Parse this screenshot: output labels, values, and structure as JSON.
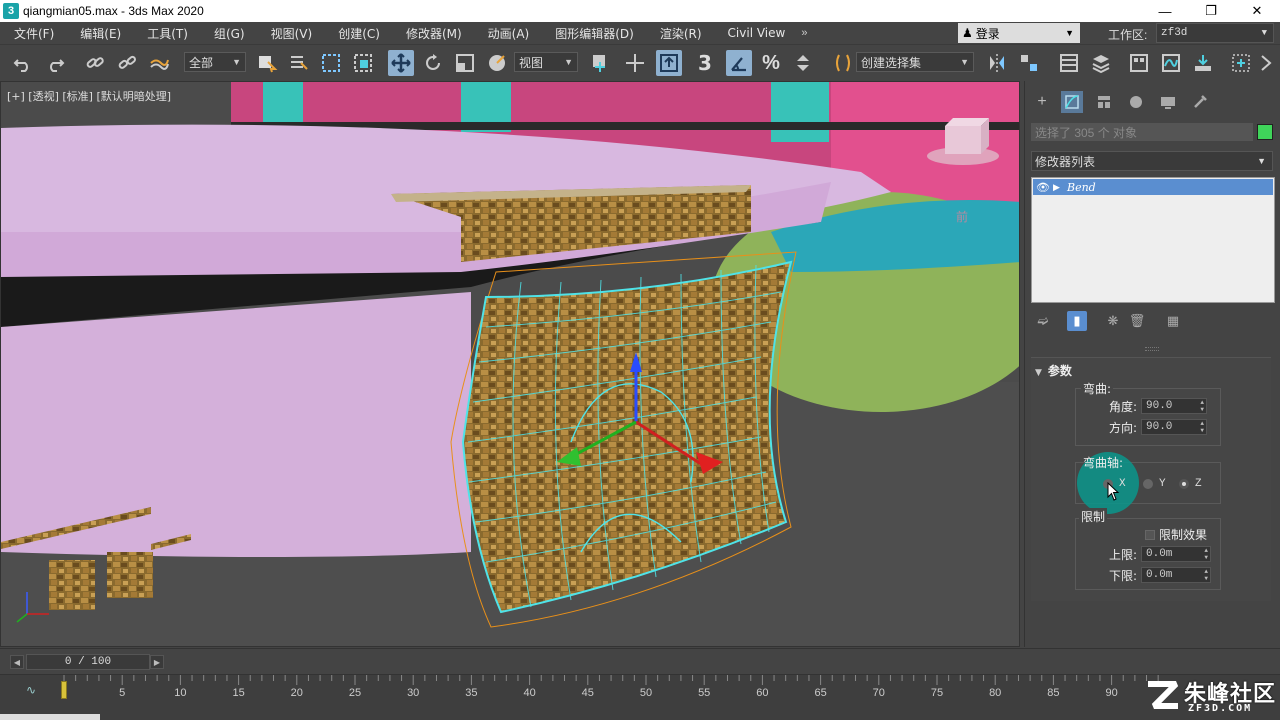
{
  "window": {
    "title": "qiangmian05.max - 3ds Max 2020",
    "app_icon": "3",
    "minimize_glyph": "—",
    "maximize_glyph": "❐",
    "close_glyph": "✕"
  },
  "menu": {
    "items": [
      "文件(F)",
      "编辑(E)",
      "工具(T)",
      "组(G)",
      "视图(V)",
      "创建(C)",
      "修改器(M)",
      "动画(A)",
      "图形编辑器(D)",
      "渲染(R)",
      "Civil View"
    ],
    "more_glyph": "»",
    "login_label": "登录",
    "workspace_label": "工作区:",
    "workspace_value": "zf3d"
  },
  "toolbar": {
    "filter_value": "全部",
    "refcoord_value": "视图",
    "named_selection_value": "创建选择集",
    "angle_snap_label": "3",
    "percent_label": "%"
  },
  "viewport": {
    "label": "[+] [透视] [标准] [默认明暗处理]",
    "viewcube_label": "前"
  },
  "command_panel": {
    "selection_text": "选择了 305 个 对象",
    "object_color": "#3fd45a",
    "modifier_list_label": "修改器列表",
    "stack_items": [
      {
        "name": "Bend"
      }
    ],
    "rollout": {
      "title": "参数",
      "bend_group_label": "弯曲:",
      "angle_label": "角度:",
      "angle_value": "90.0",
      "direction_label": "方向:",
      "direction_value": "90.0",
      "axis_group_label": "弯曲轴:",
      "axis_options": [
        "X",
        "Y",
        "Z"
      ],
      "axis_selected": "Z",
      "limits_group_label": "限制",
      "limit_effect_label": "限制效果",
      "upper_label": "上限:",
      "upper_value": "0.0m",
      "lower_label": "下限:",
      "lower_value": "0.0m"
    }
  },
  "timeline": {
    "frame_display": "0 / 100",
    "ticks": [
      "0",
      "5",
      "10",
      "15",
      "20",
      "25",
      "30",
      "35",
      "40",
      "45",
      "50",
      "55",
      "60",
      "65",
      "70",
      "75",
      "80",
      "85",
      "90"
    ]
  },
  "watermark": {
    "cn": "朱峰社区",
    "en": "ZF3D.COM"
  }
}
